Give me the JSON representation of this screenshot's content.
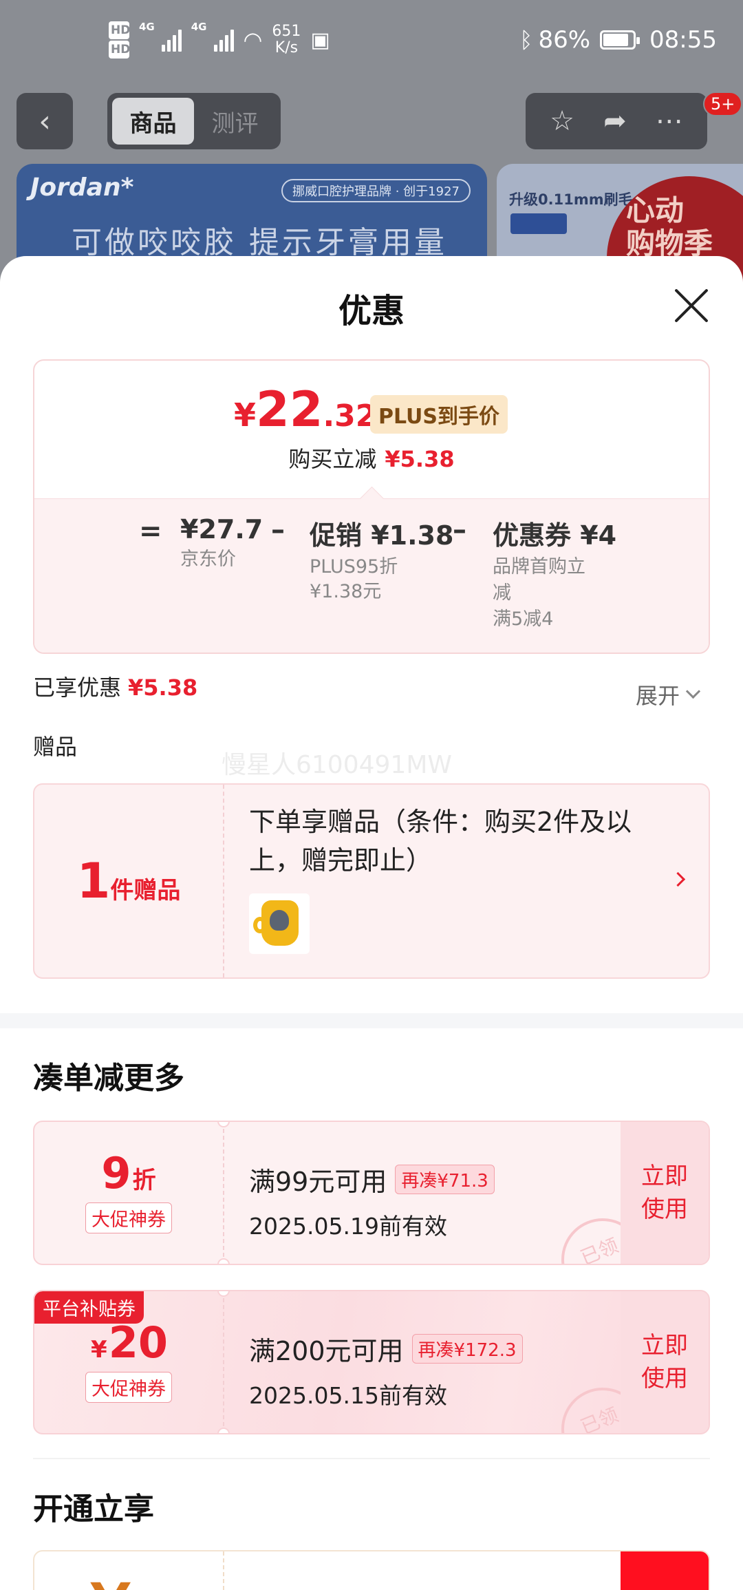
{
  "status_bar": {
    "hd1": "HD",
    "hd1_sub": "1",
    "hd2": "HD",
    "hd2_sub": "2",
    "net1": "4G",
    "net2": "4G",
    "speed_value": "651",
    "speed_unit": "K/s",
    "battery": "86%",
    "time": "08:55"
  },
  "nav": {
    "tab_product": "商品",
    "tab_review": "测评",
    "more_badge": "5+"
  },
  "background": {
    "banner_logo": "Jordan*",
    "banner_brand": "挪威口腔护理品牌 · 创于1927",
    "banner_slogan": "可做咬咬胶 提示牙膏用量",
    "side_banner_text": "升级0.11mm刷毛",
    "side_banner_red": "心动\n购物季"
  },
  "sheet": {
    "title": "优惠",
    "price": {
      "currency": "¥",
      "integer": "22",
      "decimal": ".32",
      "tag": "PLUS到手价",
      "instant_label": "购买立减",
      "instant_value": "¥5.38"
    },
    "breakdown": {
      "equals": "=",
      "minus": "–",
      "jd_price": "¥27.7",
      "jd_label": "京东价",
      "promo_title": "促销 ¥1.38",
      "promo_line1": "PLUS95折",
      "promo_line2": "¥1.38元",
      "coupon_title": "优惠券 ¥4",
      "coupon_line1": "品牌首购立",
      "coupon_line2": "减",
      "coupon_line3": "满5减4"
    },
    "enjoyed_label": "已享优惠",
    "enjoyed_value": "¥5.38",
    "expand_label": "展开",
    "gift_section": "赠品",
    "watermark": "慢星人6100491MW",
    "gift": {
      "count": "1",
      "unit": "件赠品",
      "description": "下单享赠品（条件：购买2件及以上，赠完即止）"
    },
    "more_section": "凑单减更多",
    "coupons": [
      {
        "value": "9",
        "unit": "折",
        "type": "大促神券",
        "condition": "满99元可用",
        "more": "再凑¥71.3",
        "date": "2025.05.19前有效",
        "action": "立即使用",
        "stamp": "已领"
      },
      {
        "tag": "平台补贴券",
        "currency": "¥",
        "value": "20",
        "type": "大促神券",
        "condition": "满200元可用",
        "more": "再凑¥172.3",
        "date": "2025.05.15前有效",
        "action": "立即使用",
        "stamp": "已领"
      }
    ],
    "open_section": "开通立享"
  }
}
